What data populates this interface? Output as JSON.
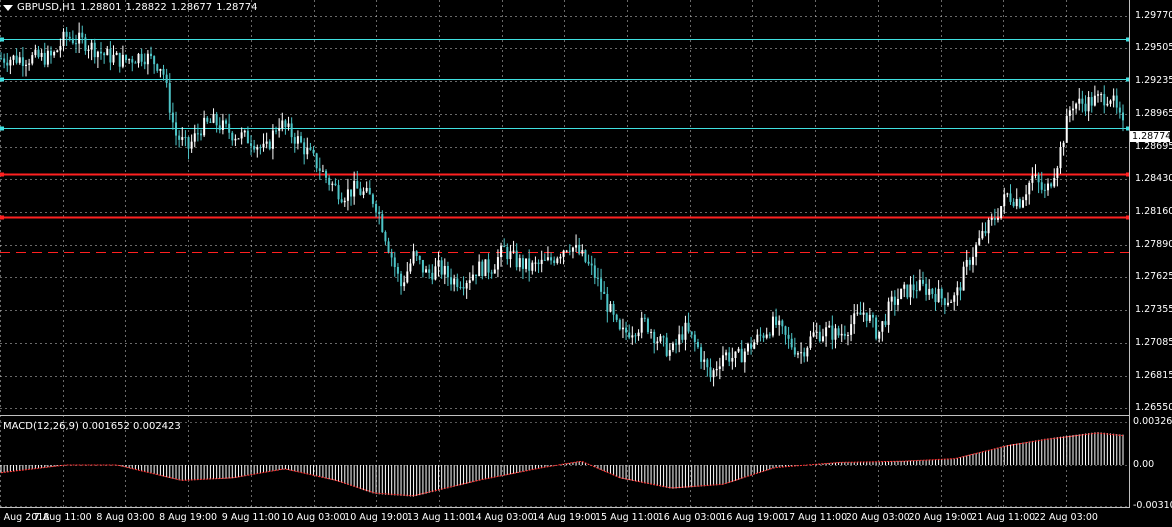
{
  "header": {
    "symbol": "GBPUSD,H1",
    "open": "1.28801",
    "high": "1.28822",
    "low": "1.28677",
    "close": "1.28774"
  },
  "macd": {
    "label": "MACD(12,26,9)",
    "value1": "0.001652",
    "value2": "0.002423",
    "ticks": [
      "0.003262",
      "0.00",
      "-0.003108"
    ]
  },
  "price_axis": {
    "ticks": [
      "1.29770",
      "1.29505",
      "1.29235",
      "1.28965",
      "1.28695",
      "1.28430",
      "1.28160",
      "1.27890",
      "1.27625",
      "1.27355",
      "1.27085",
      "1.26815",
      "1.26550"
    ],
    "current": "1.28774"
  },
  "time_axis": [
    "6 Aug 2018",
    "7 Aug 11:00",
    "8 Aug 03:00",
    "8 Aug 19:00",
    "9 Aug 11:00",
    "10 Aug 03:00",
    "10 Aug 19:00",
    "13 Aug 11:00",
    "14 Aug 03:00",
    "14 Aug 19:00",
    "15 Aug 11:00",
    "16 Aug 03:00",
    "16 Aug 19:00",
    "17 Aug 11:00",
    "20 Aug 03:00",
    "20 Aug 19:00",
    "21 Aug 11:00",
    "22 Aug 03:00"
  ],
  "colors": {
    "background": "#000000",
    "grid": "#c0c0c0",
    "bull": "#ffffff",
    "bear": "#4ec5c8",
    "cyan_level": "#40e0e0",
    "red_level": "#ff2020",
    "macd_signal": "#ff3030",
    "macd_hist": "#ffffff"
  },
  "chart_data": {
    "type": "candlestick",
    "symbol": "GBPUSD",
    "timeframe": "H1",
    "ylim": [
      1.2655,
      1.298
    ],
    "levels": [
      {
        "price": 1.2958,
        "style": "solid",
        "color": "cyan"
      },
      {
        "price": 1.2925,
        "style": "solid",
        "color": "cyan"
      },
      {
        "price": 1.2885,
        "style": "solid",
        "color": "cyan"
      },
      {
        "price": 1.2847,
        "style": "solid",
        "color": "red"
      },
      {
        "price": 1.2812,
        "style": "solid",
        "color": "red"
      },
      {
        "price": 1.2783,
        "style": "dashed",
        "color": "red"
      }
    ],
    "close_path": [
      [
        0,
        1.2942
      ],
      [
        4,
        1.2942
      ],
      [
        8,
        1.2943
      ],
      [
        10,
        1.296
      ],
      [
        13,
        1.2955
      ],
      [
        16,
        1.2945
      ],
      [
        19,
        1.294
      ],
      [
        22,
        1.2945
      ],
      [
        25,
        1.2935
      ],
      [
        27,
        1.288
      ],
      [
        29,
        1.2868
      ],
      [
        31,
        1.2885
      ],
      [
        33,
        1.289
      ],
      [
        36,
        1.288
      ],
      [
        39,
        1.2875
      ],
      [
        41,
        1.2865
      ],
      [
        43,
        1.289
      ],
      [
        46,
        1.2875
      ],
      [
        49,
        1.2855
      ],
      [
        51,
        1.284
      ],
      [
        53,
        1.283
      ],
      [
        55,
        1.2835
      ],
      [
        58,
        1.2825
      ],
      [
        60,
        1.279
      ],
      [
        62,
        1.2755
      ],
      [
        64,
        1.278
      ],
      [
        66,
        1.2765
      ],
      [
        68,
        1.277
      ],
      [
        70,
        1.276
      ],
      [
        72,
        1.276
      ],
      [
        74,
        1.277
      ],
      [
        76,
        1.277
      ],
      [
        78,
        1.2785
      ],
      [
        80,
        1.2775
      ],
      [
        82,
        1.277
      ],
      [
        85,
        1.2775
      ],
      [
        88,
        1.279
      ],
      [
        90,
        1.278
      ],
      [
        92,
        1.2765
      ],
      [
        94,
        1.274
      ],
      [
        96,
        1.2715
      ],
      [
        98,
        1.272
      ],
      [
        100,
        1.2725
      ],
      [
        102,
        1.271
      ],
      [
        104,
        1.27
      ],
      [
        106,
        1.272
      ],
      [
        108,
        1.2705
      ],
      [
        110,
        1.268
      ],
      [
        112,
        1.27
      ],
      [
        114,
        1.2695
      ],
      [
        116,
        1.2705
      ],
      [
        118,
        1.2715
      ],
      [
        120,
        1.2725
      ],
      [
        122,
        1.271
      ],
      [
        124,
        1.27
      ],
      [
        126,
        1.2715
      ],
      [
        128,
        1.2718
      ],
      [
        130,
        1.2715
      ],
      [
        132,
        1.2725
      ],
      [
        134,
        1.2735
      ],
      [
        136,
        1.2715
      ],
      [
        138,
        1.274
      ],
      [
        140,
        1.275
      ],
      [
        142,
        1.2755
      ],
      [
        144,
        1.2752
      ],
      [
        146,
        1.2745
      ],
      [
        148,
        1.2745
      ],
      [
        150,
        1.2775
      ],
      [
        152,
        1.2795
      ],
      [
        154,
        1.281
      ],
      [
        156,
        1.283
      ],
      [
        158,
        1.2825
      ],
      [
        160,
        1.2845
      ],
      [
        162,
        1.283
      ],
      [
        164,
        1.286
      ],
      [
        166,
        1.2905
      ],
      [
        168,
        1.2905
      ],
      [
        170,
        1.2908
      ],
      [
        172,
        1.2912
      ],
      [
        174,
        1.2885
      ]
    ],
    "macd_range": [
      -0.003108,
      0.003262
    ],
    "macd_signal_path": [
      [
        0,
        -0.0006
      ],
      [
        10,
        0.0
      ],
      [
        18,
        0.0
      ],
      [
        28,
        -0.0012
      ],
      [
        36,
        -0.001
      ],
      [
        44,
        -0.0003
      ],
      [
        52,
        -0.0012
      ],
      [
        58,
        -0.0022
      ],
      [
        64,
        -0.0024
      ],
      [
        74,
        -0.0012
      ],
      [
        84,
        -0.0002
      ],
      [
        90,
        0.0003
      ],
      [
        96,
        -0.001
      ],
      [
        104,
        -0.0018
      ],
      [
        112,
        -0.0015
      ],
      [
        120,
        -0.0002
      ],
      [
        130,
        0.0002
      ],
      [
        140,
        0.0003
      ],
      [
        148,
        0.0005
      ],
      [
        156,
        0.0015
      ],
      [
        162,
        0.002
      ],
      [
        170,
        0.0025
      ],
      [
        174,
        0.0023
      ]
    ]
  }
}
